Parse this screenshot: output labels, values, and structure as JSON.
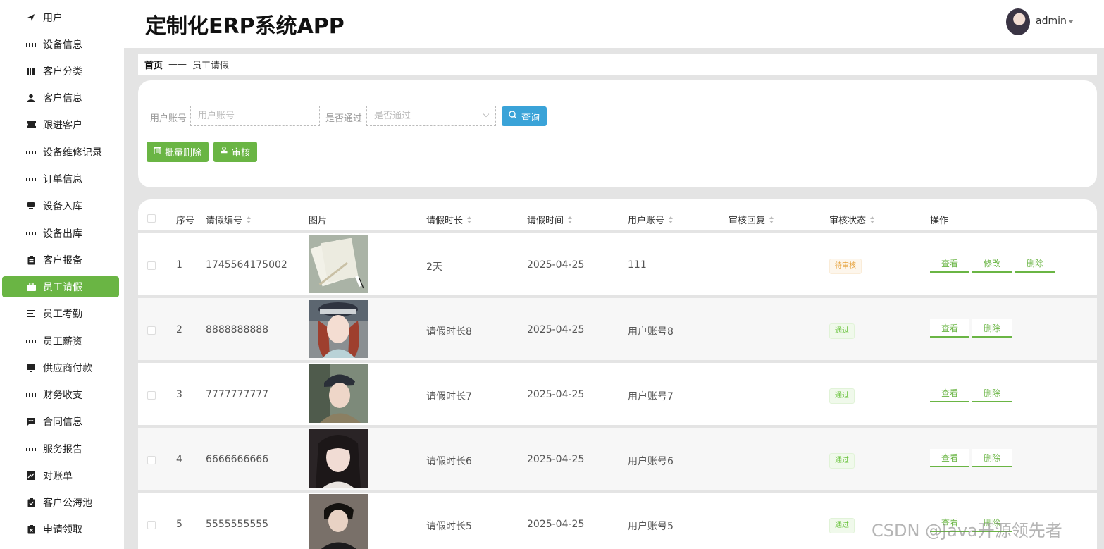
{
  "app": {
    "title": "定制化ERP系统APP",
    "user": "admin"
  },
  "sidebar": {
    "items": [
      {
        "label": "用户",
        "icon": "send-icon",
        "active": false
      },
      {
        "label": "设备信息",
        "icon": "grid-icon",
        "active": false
      },
      {
        "label": "客户分类",
        "icon": "books-icon",
        "active": false
      },
      {
        "label": "客户信息",
        "icon": "user-icon",
        "active": false
      },
      {
        "label": "跟进客户",
        "icon": "ticket-icon",
        "active": false
      },
      {
        "label": "设备维修记录",
        "icon": "grid-icon",
        "active": false
      },
      {
        "label": "订单信息",
        "icon": "grid-icon",
        "active": false
      },
      {
        "label": "设备入库",
        "icon": "inbox-icon",
        "active": false
      },
      {
        "label": "设备出库",
        "icon": "grid-icon",
        "active": false
      },
      {
        "label": "客户报备",
        "icon": "clipboard-icon",
        "active": false
      },
      {
        "label": "员工请假",
        "icon": "briefcase-icon",
        "active": true
      },
      {
        "label": "员工考勤",
        "icon": "list-icon",
        "active": false
      },
      {
        "label": "员工薪资",
        "icon": "grid-icon",
        "active": false
      },
      {
        "label": "供应商付款",
        "icon": "monitor-icon",
        "active": false
      },
      {
        "label": "财务收支",
        "icon": "grid-icon",
        "active": false
      },
      {
        "label": "合同信息",
        "icon": "message-icon",
        "active": false
      },
      {
        "label": "服务报告",
        "icon": "grid-icon",
        "active": false
      },
      {
        "label": "对账单",
        "icon": "chart-icon",
        "active": false
      },
      {
        "label": "客户公海池",
        "icon": "clipboard-check-icon",
        "active": false
      },
      {
        "label": "申请领取",
        "icon": "clipboard-x-icon",
        "active": false
      }
    ]
  },
  "breadcrumb": {
    "home": "首页",
    "separator": "——",
    "current": "员工请假"
  },
  "search": {
    "account_label": "用户账号",
    "account_placeholder": "用户账号",
    "pass_label": "是否通过",
    "pass_placeholder": "是否通过",
    "query_label": "查询",
    "batch_delete_label": "批量删除",
    "review_label": "审核"
  },
  "table": {
    "headers": {
      "index": "序号",
      "leave_no": "请假编号",
      "image": "图片",
      "duration": "请假时长",
      "time": "请假时间",
      "account": "用户账号",
      "reply": "审核回复",
      "status": "审核状态",
      "actions": "操作"
    },
    "rows": [
      {
        "index": "1",
        "leave_no": "1745564175002",
        "duration": "2天",
        "time": "2025-04-25",
        "account": "111",
        "reply": "",
        "status": "待审核",
        "ops": [
          "查看",
          "修改",
          "删除"
        ]
      },
      {
        "index": "2",
        "leave_no": "8888888888",
        "duration": "请假时长8",
        "time": "2025-04-25",
        "account": "用户账号8",
        "reply": "",
        "status": "通过",
        "ops": [
          "查看",
          "删除"
        ]
      },
      {
        "index": "3",
        "leave_no": "7777777777",
        "duration": "请假时长7",
        "time": "2025-04-25",
        "account": "用户账号7",
        "reply": "",
        "status": "通过",
        "ops": [
          "查看",
          "删除"
        ]
      },
      {
        "index": "4",
        "leave_no": "6666666666",
        "duration": "请假时长6",
        "time": "2025-04-25",
        "account": "用户账号6",
        "reply": "",
        "status": "通过",
        "ops": [
          "查看",
          "删除"
        ]
      },
      {
        "index": "5",
        "leave_no": "5555555555",
        "duration": "请假时长5",
        "time": "2025-04-25",
        "account": "用户账号5",
        "reply": "",
        "status": "通过",
        "ops": [
          "查看",
          "删除"
        ]
      }
    ]
  },
  "watermark": "CSDN @Java开源领先者",
  "colors": {
    "accent": "#6ab544",
    "query": "#3aa3d8",
    "pending": "#e6a23c",
    "pass": "#67c23a"
  }
}
